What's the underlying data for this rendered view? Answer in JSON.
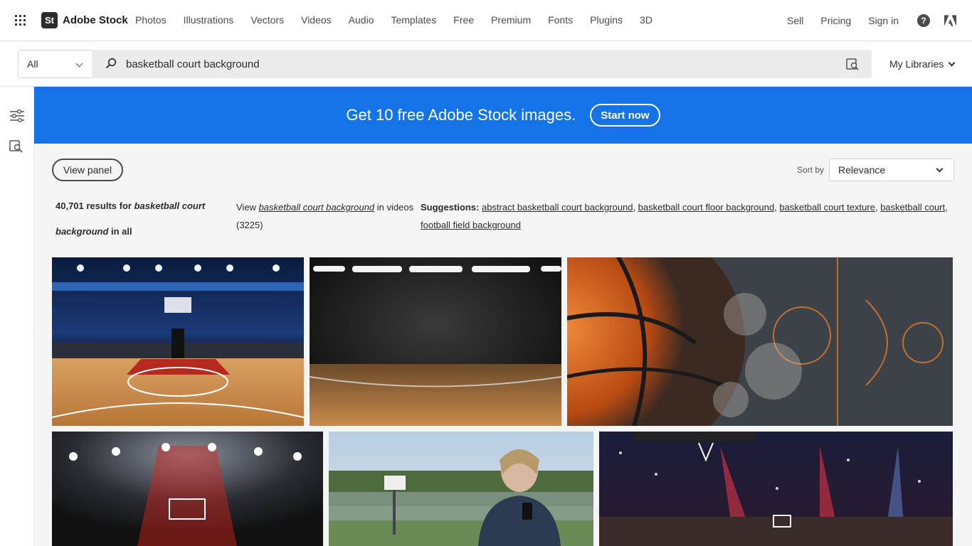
{
  "brand": {
    "mark": "St",
    "name": "Adobe Stock"
  },
  "nav": {
    "items": [
      "Photos",
      "Illustrations",
      "Vectors",
      "Videos",
      "Audio",
      "Templates",
      "Free",
      "Premium",
      "Fonts",
      "Plugins",
      "3D"
    ],
    "right": {
      "sell": "Sell",
      "pricing": "Pricing",
      "signin": "Sign in"
    }
  },
  "search": {
    "scope": "All",
    "query": "basketball court background",
    "my_libraries": "My Libraries"
  },
  "banner": {
    "text": "Get 10 free Adobe Stock images.",
    "button": "Start now",
    "color": "#1473e6"
  },
  "controls": {
    "view_panel": "View panel",
    "sort_label": "Sort by",
    "sort_value": "Relevance"
  },
  "results": {
    "count_prefix": "40,701 results for ",
    "query": "basketball court background",
    "suffix": " in all",
    "view_prefix": "View ",
    "view_suffix": " in videos",
    "video_count": "(3225)"
  },
  "suggestions": {
    "label": "Suggestions:",
    "items": [
      "abstract basketball court background",
      "basketball court floor background",
      "basketball court texture",
      "basketball court",
      "football field background"
    ]
  },
  "thumbnails": [
    {
      "name": "arena-court-spotlights"
    },
    {
      "name": "dark-wooden-floor-lights"
    },
    {
      "name": "basketball-ball-court-texture"
    },
    {
      "name": "red-arena-spotlights"
    },
    {
      "name": "woman-phone-outdoor-court"
    },
    {
      "name": "crowded-arena-hoop"
    }
  ]
}
